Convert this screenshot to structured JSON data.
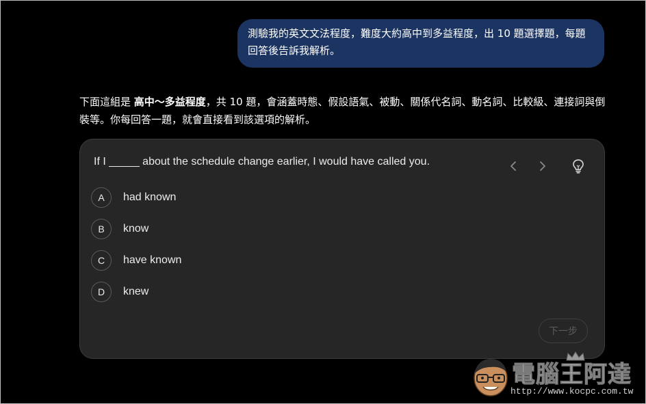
{
  "user_message": "測驗我的英文文法程度，難度大約高中到多益程度，出 10 題選擇題，每題回答後告訴我解析。",
  "response": {
    "intro_before": "下面這組是 ",
    "intro_bold": "高中～多益程度",
    "intro_after": "，共 10 題，會涵蓋時態、假設語氣、被動、關係代名詞、動名詞、比較級、連接詞與倒裝等。你每回答一題，就會直接看到該選項的解析。"
  },
  "quiz": {
    "question": "If I _____ about the schedule change earlier, I would have called you.",
    "options": [
      {
        "letter": "A",
        "text": "had known"
      },
      {
        "letter": "B",
        "text": "know"
      },
      {
        "letter": "C",
        "text": "have known"
      },
      {
        "letter": "D",
        "text": "knew"
      }
    ],
    "prev_icon": "chevron-left-icon",
    "next_icon": "chevron-right-icon",
    "hint_icon": "lightbulb-icon",
    "next_label": "下一步"
  },
  "watermark": {
    "title": "電腦王阿達",
    "url": "http://www.kocpc.com.tw"
  }
}
